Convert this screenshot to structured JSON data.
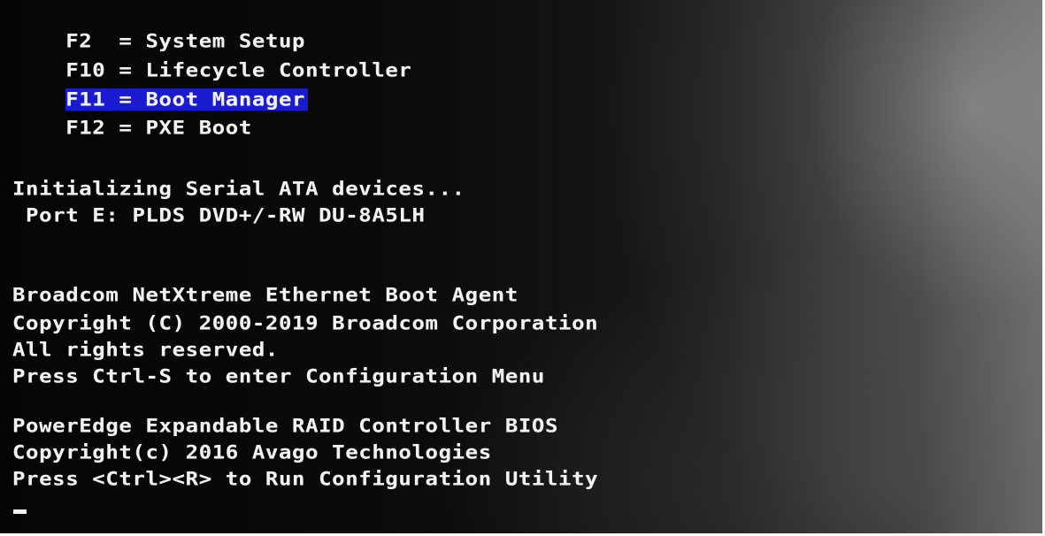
{
  "hotkeys": [
    {
      "label": "F2  = System Setup",
      "highlighted": false
    },
    {
      "label": "F10 = Lifecycle Controller",
      "highlighted": false
    },
    {
      "label": "F11 = Boot Manager",
      "highlighted": true
    },
    {
      "label": "F12 = PXE Boot",
      "highlighted": false
    }
  ],
  "sata": {
    "init": "Initializing Serial ATA devices...",
    "port": " Port E: PLDS DVD+/-RW DU-8A5LH"
  },
  "broadcom": {
    "name": "Broadcom NetXtreme Ethernet Boot Agent",
    "copyright": "Copyright (C) 2000-2019 Broadcom Corporation",
    "rights": "All rights reserved.",
    "prompt": "Press Ctrl-S to enter Configuration Menu"
  },
  "raid": {
    "name": "PowerEdge Expandable RAID Controller BIOS",
    "copyright": "Copyright(c) 2016 Avago Technologies",
    "prompt": "Press <Ctrl><R> to Run Configuration Utility"
  },
  "colors": {
    "highlight": "#1a1ad0",
    "text": "#f2f2f2",
    "background": "#0b0b0b"
  }
}
